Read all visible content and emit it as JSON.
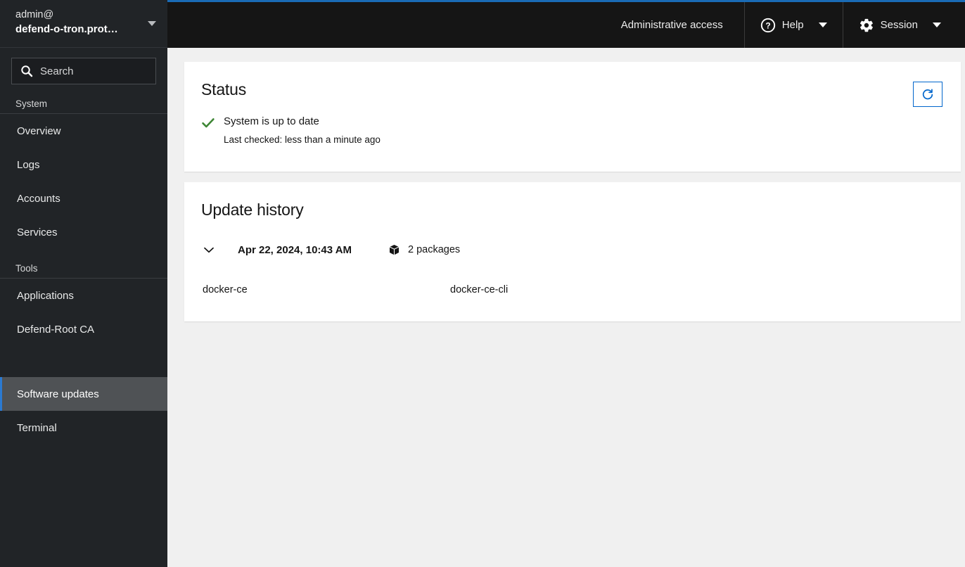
{
  "sidebar": {
    "user": {
      "line1": "admin@",
      "line2": "defend-o-tron.prot…",
      "caret_icon": "chevron-down-icon"
    },
    "search": {
      "placeholder": "Search",
      "value": "Search",
      "icon": "search-icon"
    },
    "groups": [
      {
        "label": "System",
        "items": [
          {
            "label": "Overview",
            "active": false
          },
          {
            "label": "Logs",
            "active": false
          },
          {
            "label": "Accounts",
            "active": false
          },
          {
            "label": "Services",
            "active": false
          }
        ]
      },
      {
        "label": "Tools",
        "items": [
          {
            "label": "Applications",
            "active": false
          },
          {
            "label": "Defend-Root CA",
            "active": false
          }
        ]
      }
    ],
    "bottom_items": [
      {
        "label": "Software updates",
        "active": true
      },
      {
        "label": "Terminal",
        "active": false
      }
    ],
    "colors": {
      "background": "#212427",
      "active_background": "#4f5255",
      "active_accent": "#2b7ad1"
    }
  },
  "header": {
    "admin_access_label": "Administrative access",
    "help_label": "Help",
    "help_icon": "help-circle-icon",
    "session_label": "Session",
    "session_icon": "gear-icon",
    "caret_icon": "chevron-down-icon",
    "accent_color": "#1a6bb5",
    "background": "#151515"
  },
  "status_card": {
    "title": "Status",
    "state_icon": "check-icon",
    "state_color": "#3e8635",
    "state_text": "System is up to date",
    "last_checked": "Last checked: less than a minute ago",
    "refresh_icon": "refresh-icon",
    "refresh_color": "#0066cc"
  },
  "update_history": {
    "title": "Update history",
    "entries": [
      {
        "expand_icon": "chevron-down-icon",
        "date": "Apr 22, 2024, 10:43 AM",
        "package_icon": "package-icon",
        "package_count": "2 packages",
        "packages": [
          "docker-ce",
          "docker-ce-cli"
        ]
      }
    ]
  }
}
